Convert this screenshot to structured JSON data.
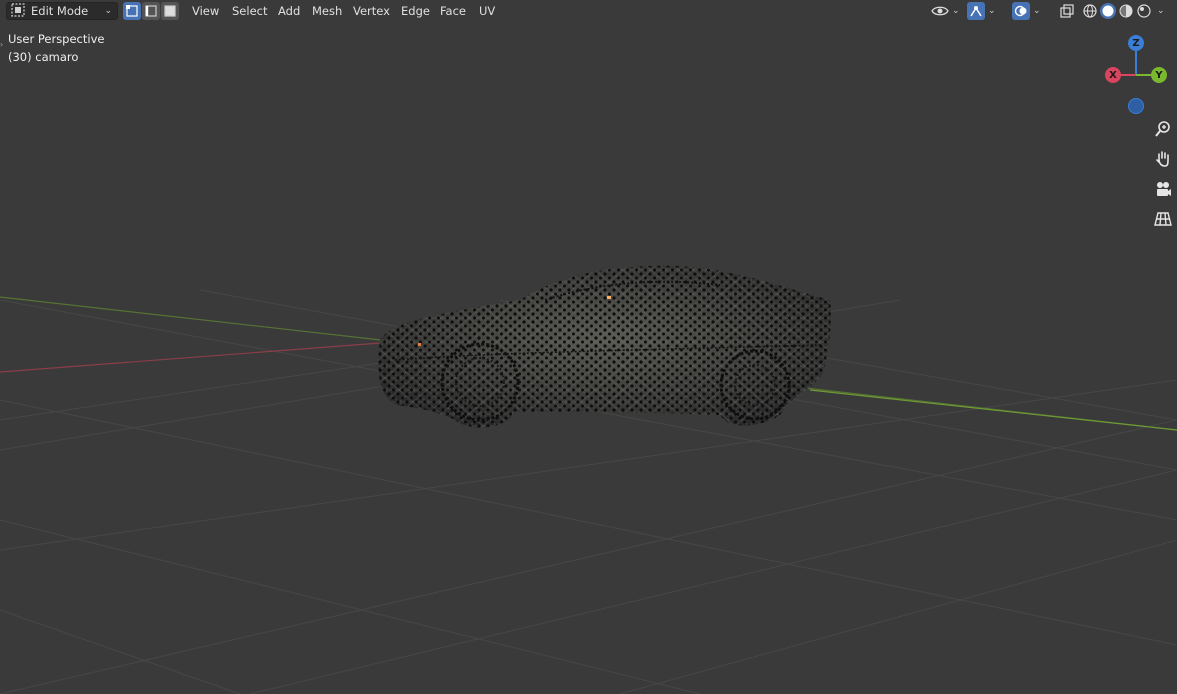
{
  "header": {
    "mode_label": "Edit Mode",
    "menus": [
      "View",
      "Select",
      "Add",
      "Mesh",
      "Vertex",
      "Edge",
      "Face",
      "UV"
    ]
  },
  "overlay": {
    "view_name": "User Perspective",
    "object_label": "(30) camaro"
  },
  "gizmo": {
    "z_label": "Z",
    "x_label": "X",
    "y_label": "Y"
  },
  "colors": {
    "background": "#3a3a3a",
    "axis_x": "#d9455f",
    "axis_y": "#7ab82e",
    "axis_z": "#3a7ed8",
    "accent": "#4772b3"
  },
  "icons": {
    "editor_type": "editor-type-icon",
    "vertex_select": "vertex-select-icon",
    "edge_select": "edge-select-icon",
    "face_select": "face-select-icon",
    "visibility": "eye-icon",
    "gizmo_toggle": "gizmo-icon",
    "overlay_toggle": "overlay-icon",
    "xray": "xray-icon",
    "zoom": "zoom-icon",
    "pan": "hand-icon",
    "camera": "camera-icon",
    "ortho": "grid-icon"
  }
}
